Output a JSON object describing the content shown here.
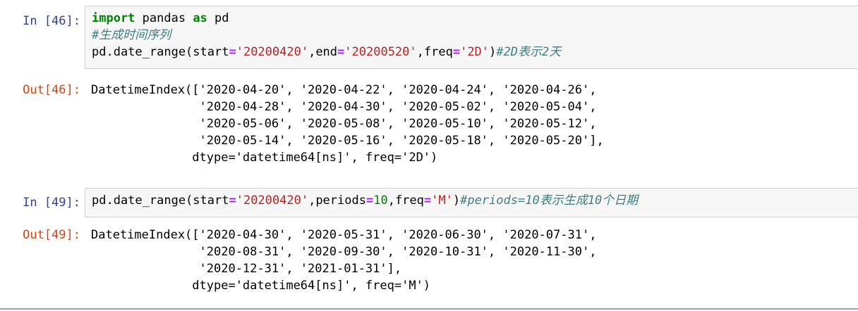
{
  "cells": [
    {
      "in_prompt": "In [46]:",
      "out_prompt": "Out[46]:",
      "code": {
        "line1": {
          "kw1": "import",
          "mod": " pandas ",
          "kw2": "as",
          "alias": " pd"
        },
        "line2": {
          "comment": "#生成时间序列"
        },
        "line3": {
          "call": "pd.date_range(start",
          "eq1": "=",
          "start": "'20200420'",
          "sep1": ",end",
          "eq2": "=",
          "end": "'20200520'",
          "sep2": ",freq",
          "eq3": "=",
          "freq": "'2D'",
          "close": ")",
          "comment": "#2D表示2天"
        }
      },
      "output_lines": [
        "DatetimeIndex(['2020-04-20', '2020-04-22', '2020-04-24', '2020-04-26',",
        "               '2020-04-28', '2020-04-30', '2020-05-02', '2020-05-04',",
        "               '2020-05-06', '2020-05-08', '2020-05-10', '2020-05-12',",
        "               '2020-05-14', '2020-05-16', '2020-05-18', '2020-05-20'],",
        "              dtype='datetime64[ns]', freq='2D')"
      ]
    },
    {
      "in_prompt": "In [49]:",
      "out_prompt": "Out[49]:",
      "code": {
        "line1": {
          "call": "pd.date_range(start",
          "eq1": "=",
          "start": "'20200420'",
          "sep1": ",periods",
          "eq2": "=",
          "periods": "10",
          "sep2": ",freq",
          "eq3": "=",
          "freq": "'M'",
          "close": ")",
          "comment": "#periods=10表示生成10个日期"
        }
      },
      "output_lines": [
        "DatetimeIndex(['2020-04-30', '2020-05-31', '2020-06-30', '2020-07-31',",
        "               '2020-08-31', '2020-09-30', '2020-10-31', '2020-11-30',",
        "               '2020-12-31', '2021-01-31'],",
        "              dtype='datetime64[ns]', freq='M')"
      ]
    }
  ]
}
